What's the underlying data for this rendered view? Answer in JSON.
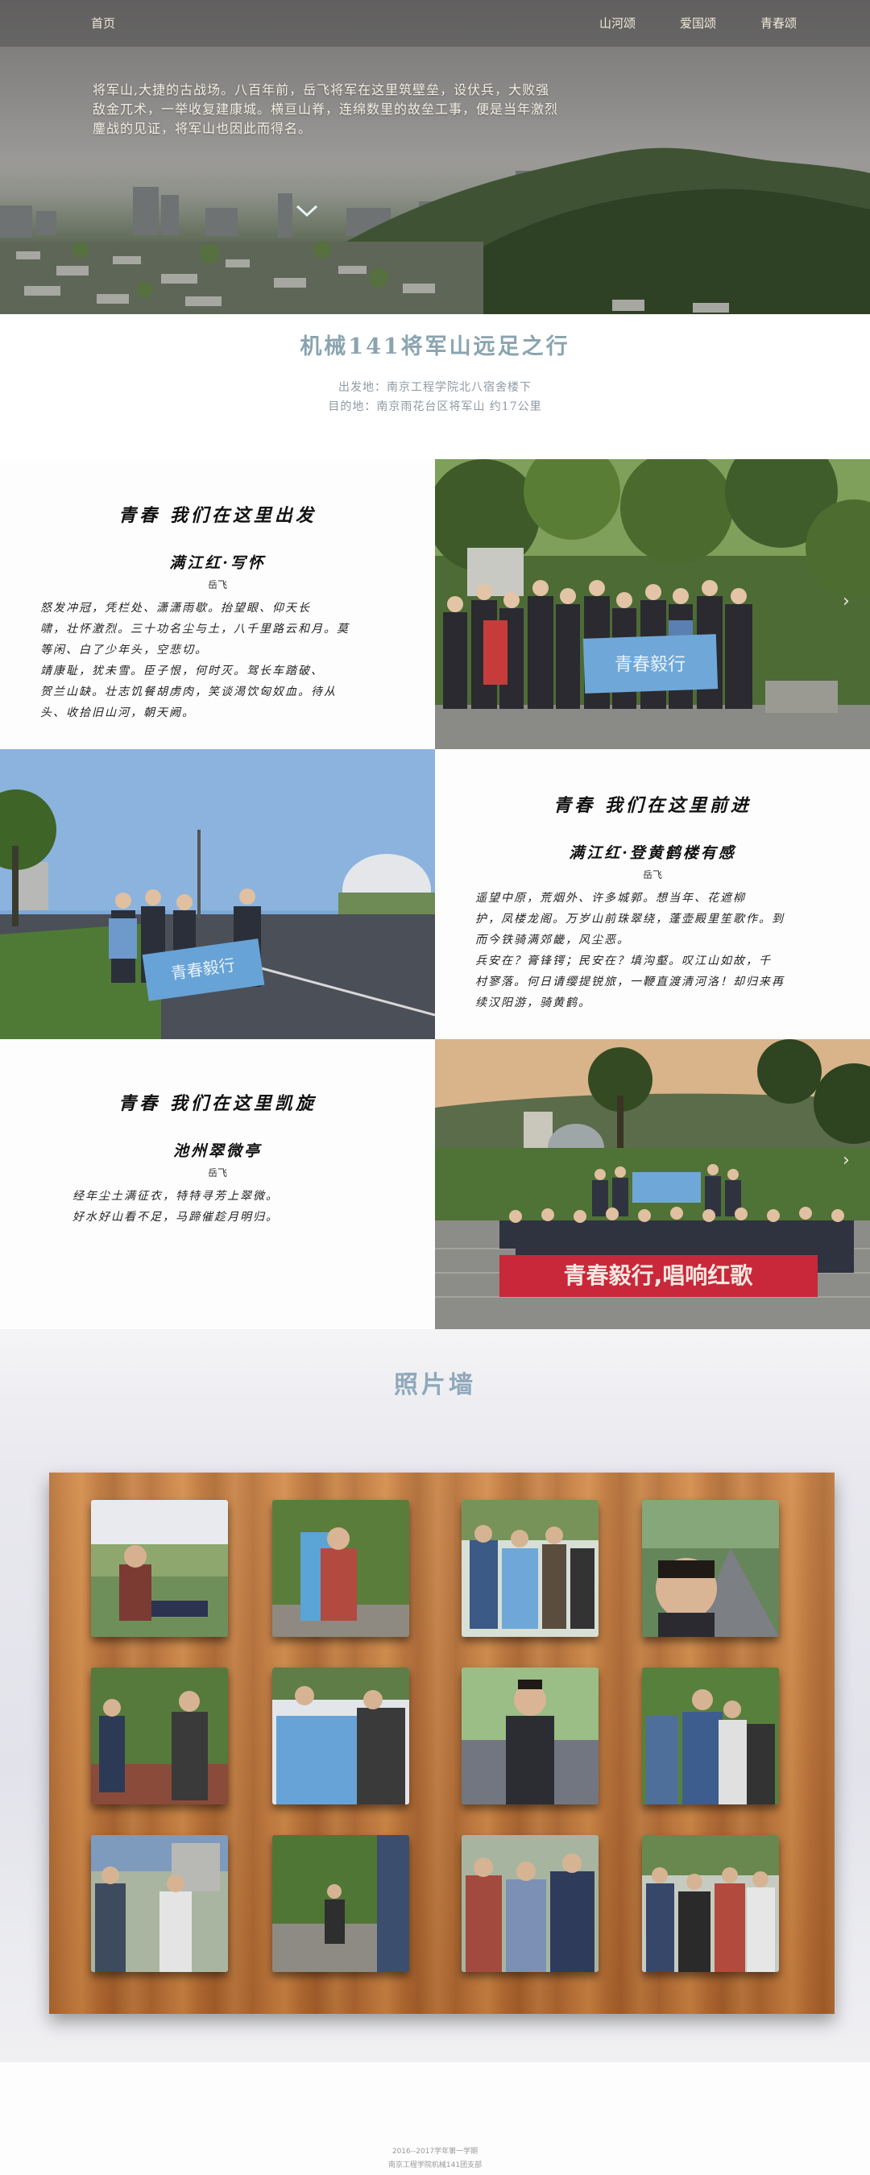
{
  "nav": {
    "home": "首页",
    "items": [
      "山河颂",
      "爱国颂",
      "青春颂"
    ]
  },
  "hero": {
    "text": "将军山,大捷的古战场。八百年前，岳飞将军在这里筑壁垒，设伏兵，大败强敌金兀术，一举收复建康城。横亘山脊，连绵数里的故垒工事，便是当年激烈鏖战的见证，将军山也因此而得名。"
  },
  "trip": {
    "title": "机械141将军山远足之行",
    "from": "出发地：南京工程学院北八宿舍楼下",
    "to": "目的地：南京雨花台区将军山  约17公里"
  },
  "stories": [
    {
      "heading": "青春  我们在这里出发",
      "poem_title": "满江红·写怀",
      "author": "岳飞",
      "lines": [
        "怒发冲冠，凭栏处、潇潇雨歇。抬望眼、仰天长",
        "啸，壮怀激烈。三十功名尘与土，八千里路云和月。莫",
        "等闲、白了少年头，空悲切。",
        "靖康耻，犹未雪。臣子恨，何时灭。驾长车踏破、",
        "贺兰山缺。壮志饥餐胡虏肉，笑谈渴饮匈奴血。待从",
        "头、收拾旧山河，朝天阙。"
      ]
    },
    {
      "heading": "青春  我们在这里前进",
      "poem_title": "满江红·登黄鹤楼有感",
      "author": "岳飞",
      "lines": [
        "遥望中原，荒烟外、许多城郭。想当年、花遮柳",
        "护，凤楼龙阁。万岁山前珠翠绕，蓬壶殿里笙歌作。到",
        "而今铁骑满郊畿，风尘恶。",
        "兵安在？膏锋锷；民安在？填沟壑。叹江山如故，千",
        "村寥落。何日请缨提锐旅，一鞭直渡清河洛！却归来再",
        "续汉阳游，骑黄鹤。"
      ]
    },
    {
      "heading": "青春  我们在这里凯旋",
      "poem_title": "池州翠微亭",
      "author": "岳飞",
      "lines": [
        "经年尘土满征衣，特特寻芳上翠微。",
        "好水好山看不足，马蹄催趁月明归。"
      ]
    }
  ],
  "banners": {
    "flag": "青春毅行",
    "red_banner": "青春毅行,唱响红歌"
  },
  "photo_wall": {
    "heading": "照片墙",
    "photo_count": 12
  },
  "footer": {
    "line1": "2016--2017学年第一学期",
    "line2": "南京工程学院机械141团支部"
  },
  "colors": {
    "title_blue": "#8aa4b0",
    "wood": "#c27a3e",
    "banner_red": "#c8283a",
    "flag_blue": "#6fa8d8"
  }
}
